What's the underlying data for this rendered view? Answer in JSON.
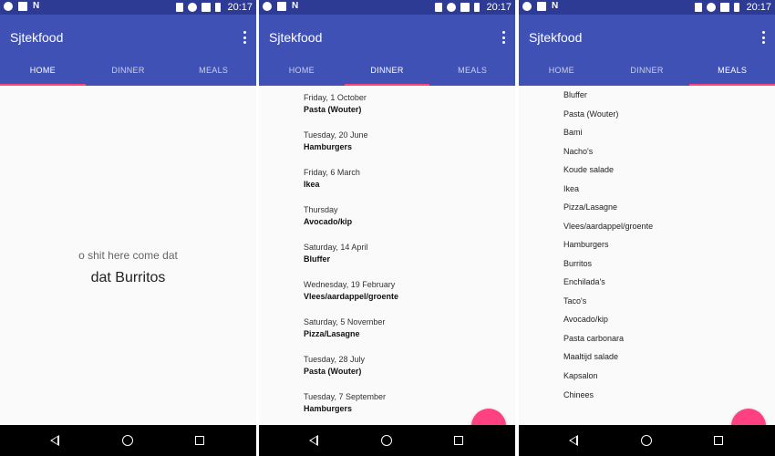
{
  "status_bar": {
    "time": "20:17"
  },
  "app": {
    "title": "Sjtekfood"
  },
  "tabs": {
    "home": "HOME",
    "dinner": "DINNER",
    "meals": "MEALS"
  },
  "colors": {
    "primary": "#3f51b5",
    "primary_dark": "#2e3b94",
    "accent": "#ff4081"
  },
  "home": {
    "subtitle": "o shit here come dat",
    "main": "dat Burritos"
  },
  "dinner": {
    "entries": [
      {
        "date": "Friday, 1 October",
        "meal": "Pasta (Wouter)"
      },
      {
        "date": "Tuesday, 20 June",
        "meal": "Hamburgers"
      },
      {
        "date": "Friday, 6 March",
        "meal": "Ikea"
      },
      {
        "date": "Thursday",
        "meal": "Avocado/kip"
      },
      {
        "date": "Saturday, 14 April",
        "meal": "Bluffer"
      },
      {
        "date": "Wednesday, 19 February",
        "meal": "Vlees/aardappel/groente"
      },
      {
        "date": "Saturday, 5 November",
        "meal": "Pizza/Lasagne"
      },
      {
        "date": "Tuesday, 28 July",
        "meal": "Pasta (Wouter)"
      },
      {
        "date": "Tuesday, 7 September",
        "meal": "Hamburgers"
      }
    ]
  },
  "meals": {
    "items": [
      "Bluffer",
      "Pasta (Wouter)",
      "Bami",
      "Nacho's",
      "Koude salade",
      "Ikea",
      "Pizza/Lasagne",
      "Vlees/aardappel/groente",
      "Hamburgers",
      "Burritos",
      "Enchilada's",
      "Taco's",
      "Avocado/kip",
      "Pasta carbonara",
      "Maaltijd salade",
      "Kapsalon",
      "Chinees"
    ]
  }
}
